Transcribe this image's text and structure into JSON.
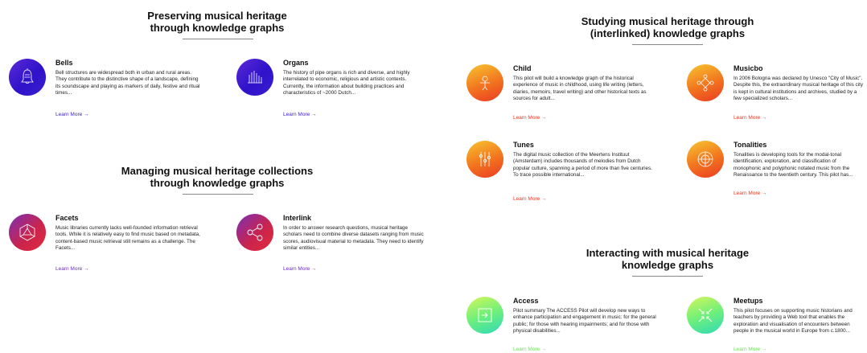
{
  "sections": {
    "preserving": {
      "title": "Preserving musical heritage\nthrough knowledge graphs"
    },
    "managing": {
      "title": "Managing musical heritage collections\nthrough knowledge graphs"
    },
    "studying": {
      "title": "Studying musical heritage through\n(interlinked) knowledge graphs"
    },
    "interacting": {
      "title": "Interacting with musical heritage\nknowledge graphs"
    }
  },
  "cards": {
    "bells": {
      "title": "Bells",
      "desc": "Bell structures are widespread both in urban and rural areas. They contribute to the distinctive shape of a landscape, defining its soundscape and playing as markers of daily, festive and ritual times...",
      "link": "Learn More →",
      "icon": "bell-icon"
    },
    "organs": {
      "title": "Organs",
      "desc": "The history of pipe organs is rich and diverse, and highly interrelated to economic, religious and artistic contexts. Currently, the information about building practices and characteristics of ~2000 Dutch...",
      "link": "Learn More →",
      "icon": "organ-pipes-icon"
    },
    "facets": {
      "title": "Facets",
      "desc": "Music libraries currently lacks well-founded information retrieval tools. While it is relatively easy to find music based on metadata, content-based music retrieval still remains as a challenge. The Facets...",
      "link": "Learn More →",
      "icon": "polyhedron-icon"
    },
    "interlink": {
      "title": "Interlink",
      "desc": "In order to answer research questions, musical heritage scholars need to combine diverse datasets ranging from music scores, audiovisual material to metadata. They need to identify similar entities...",
      "link": "Learn More →",
      "icon": "share-nodes-icon"
    },
    "child": {
      "title": "Child",
      "desc": "This pilot will build a knowledge graph of the historical experience of music in childhood, using life writing (letters, diaries, memoirs, travel writing) and other historical texts as sources for adult...",
      "link": "Learn More →",
      "icon": "child-icon"
    },
    "musicbo": {
      "title": "Musicbo",
      "desc": "In 2006 Bologna was declared by Unesco \"City of Music\". Despite this, the extraordinary musical heritage of this city is kept in cultural institutions and archives, studied by a few specialized scholars...",
      "link": "Learn More →",
      "icon": "ornament-icon"
    },
    "tunes": {
      "title": "Tunes",
      "desc": "The digital music collection of the Meertens Instituut (Amsterdam) includes thousands of melodies from Dutch popular culture, spanning a period of more than five centuries. To trace possible international...",
      "link": "Learn More →",
      "icon": "tuning-icon"
    },
    "tonalities": {
      "title": "Tonalities",
      "desc": "Tonalities is developing tools for the modal-tonal identification, exploration, and classification of monophonic and polyphonic notated music from the Renaissance to the twentieth century. This pilot has...",
      "link": "Learn More →",
      "icon": "circle-of-fifths-icon"
    },
    "access": {
      "title": "Access",
      "desc": "Pilot summary  The ACCESS Pilot will develop new ways to enhance participation and engagement in music:  for the general public; for those with hearing impairments; and for those with physical disabilities...",
      "link": "Learn More →",
      "icon": "door-arrow-icon"
    },
    "meetups": {
      "title": "Meetups",
      "desc": "This pilot focuses on supporting music historians and teachers by providing a Web tool that enables the exploration and visualisation of encounters between people in the musical world in Europe from c.1800...",
      "link": "Learn More →",
      "icon": "converging-arrows-icon"
    }
  }
}
